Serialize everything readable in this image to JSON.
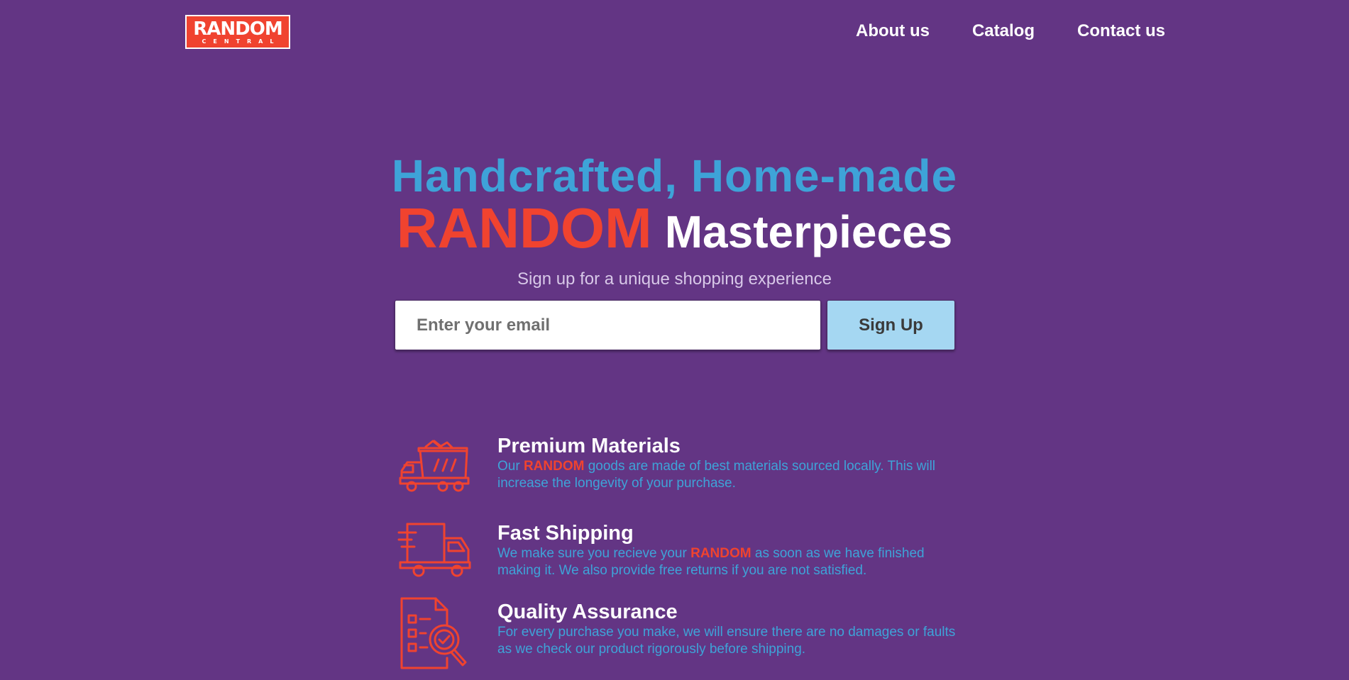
{
  "header": {
    "logo": {
      "main": "RANDOM",
      "sub": "CENTRAL"
    },
    "nav": [
      {
        "label": "About us"
      },
      {
        "label": "Catalog"
      },
      {
        "label": "Contact us"
      }
    ]
  },
  "hero": {
    "line1": "Handcrafted, Home-made",
    "brand": "RANDOM",
    "line2_rest": "Masterpieces",
    "tagline": "Sign up for a unique shopping experience",
    "email_placeholder": "Enter your email",
    "email_value": "",
    "signup_label": "Sign Up"
  },
  "features": [
    {
      "icon": "materials-cart-icon",
      "title": "Premium Materials",
      "desc_before": "Our ",
      "desc_highlight": "RANDOM",
      "desc_after": " goods are made of best materials sourced locally. This will increase the longevity of your purchase."
    },
    {
      "icon": "delivery-truck-icon",
      "title": "Fast Shipping",
      "desc_before": "We make sure you recieve your ",
      "desc_highlight": "RANDOM",
      "desc_after": " as soon as we have finished making it. We also provide free returns if you are not satisfied."
    },
    {
      "icon": "quality-inspection-icon",
      "title": "Quality Assurance",
      "desc_before": "For every purchase you make, we will ensure there are no damages or faults as we check our product rigorously before shipping.",
      "desc_highlight": "",
      "desc_after": ""
    }
  ],
  "colors": {
    "background": "#633584",
    "accent_red": "#f0432f",
    "accent_blue": "#3ea3d8",
    "button_blue": "#a5d7f2"
  }
}
